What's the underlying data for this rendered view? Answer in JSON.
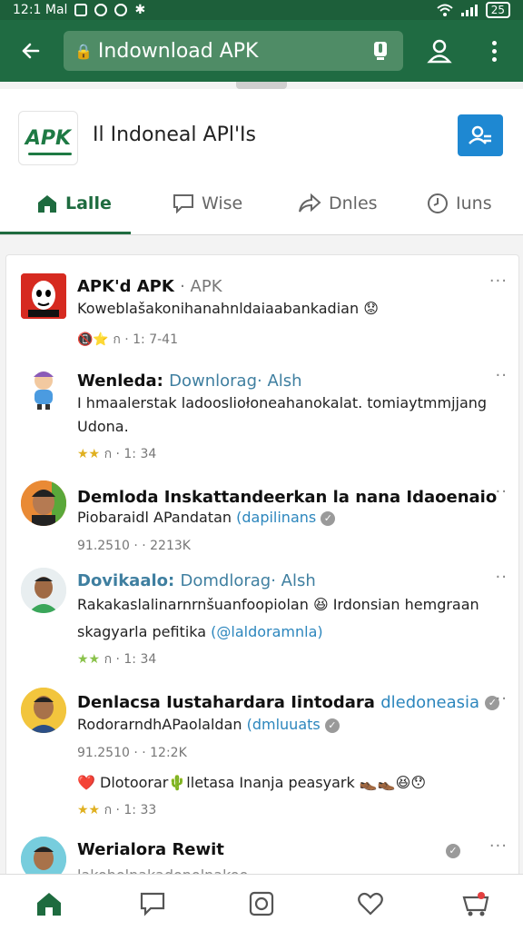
{
  "status_bar": {
    "time": "12:1 Mal",
    "battery": "25"
  },
  "app_bar": {
    "url": "Indownload APK"
  },
  "site": {
    "logo_text": "APK",
    "name": "Il Indoneal APl'Is"
  },
  "tabs": [
    {
      "label": "Lalle",
      "icon": "home-icon",
      "active": true
    },
    {
      "label": "Wise",
      "icon": "chat-icon",
      "active": false
    },
    {
      "label": "Dnles",
      "icon": "share-icon",
      "active": false
    },
    {
      "label": "Iuns",
      "icon": "clock-icon",
      "active": false
    }
  ],
  "posts": [
    {
      "title": "APK'd APK",
      "title_suffix": "· APK",
      "text": "Koweblašakonihanahnldaiaabankadian 😟",
      "meta": "📵⭐ ก · 1: 7-41"
    },
    {
      "title": "Wenleda:",
      "title_handle": "Downlorag· Alsh",
      "text": "I hmaalerstak ladoosliołoneahanokalat. tomiaytmmjjang Udona.",
      "stars": "★★",
      "meta": "ก · 1: 34"
    },
    {
      "title": "Demloda Inskattandeerkan la nana Idaoenaio",
      "text_plain": "Piobaraidl APandatan",
      "text_link": "(dapilinans",
      "meta": "91.2510 · · 2213K"
    },
    {
      "title": "Dovikaalo:",
      "title_handle": "Domdlorag· Alsh",
      "text": "Rakakaslalinarnrnšuanfoopiolan 😆 Irdonsian hemgraan skagyarla pefitika",
      "text_link": "(@laldoramnla)",
      "stars": "★★",
      "meta": "ก · 1: 34"
    },
    {
      "title": "Denlacsa Iustahardara Iintodara",
      "title_handle": "dledoneasia",
      "text_plain": "RodorarndhAPaolaldan",
      "text_link": "(dmluuats",
      "meta": "91.2510 · · 12:2K",
      "extra": "❤️ Dlotoorar🌵lletasa Inanja peasyark 👞👞😆😯",
      "stars": "★★",
      "meta2": "ก · 1: 33"
    },
    {
      "title": "Werialora Rewit",
      "text": "lakoholnakadonolnakoo..."
    }
  ],
  "bottom_nav": [
    "home-icon",
    "chat-icon",
    "camera-icon",
    "heart-icon",
    "cart-icon"
  ]
}
